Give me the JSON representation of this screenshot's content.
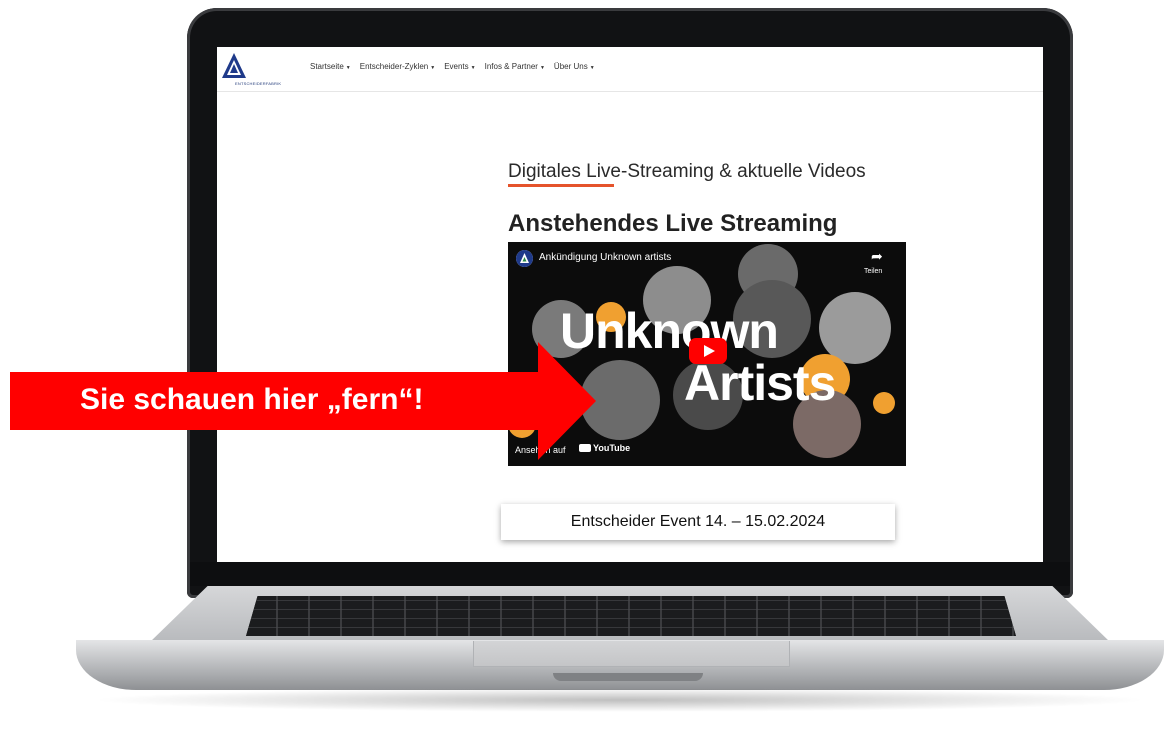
{
  "nav": {
    "logo_text": "ENTSCHEIDERFABRIK",
    "items": [
      {
        "label": "Startseite"
      },
      {
        "label": "Entscheider-Zyklen"
      },
      {
        "label": "Events"
      },
      {
        "label": "Infos & Partner"
      },
      {
        "label": "Über Uns"
      }
    ]
  },
  "main": {
    "section_heading": "Digitales Live-Streaming & aktuelle Videos",
    "headline": "Anstehendes Live Streaming",
    "video": {
      "title": "Ankündigung Unknown artists",
      "share_label": "Teilen",
      "overlay_line1": "Unknown",
      "overlay_line2": "Artists",
      "watch_on": "Ansehen auf",
      "platform": "YouTube"
    },
    "event_button": "Entscheider Event 14. – 15.02.2024"
  },
  "callout": {
    "text": "Sie schauen hier „fern“!",
    "color": "#ff0000"
  },
  "colors": {
    "accent_underline": "#e5532b",
    "youtube_red": "#ff0000"
  }
}
